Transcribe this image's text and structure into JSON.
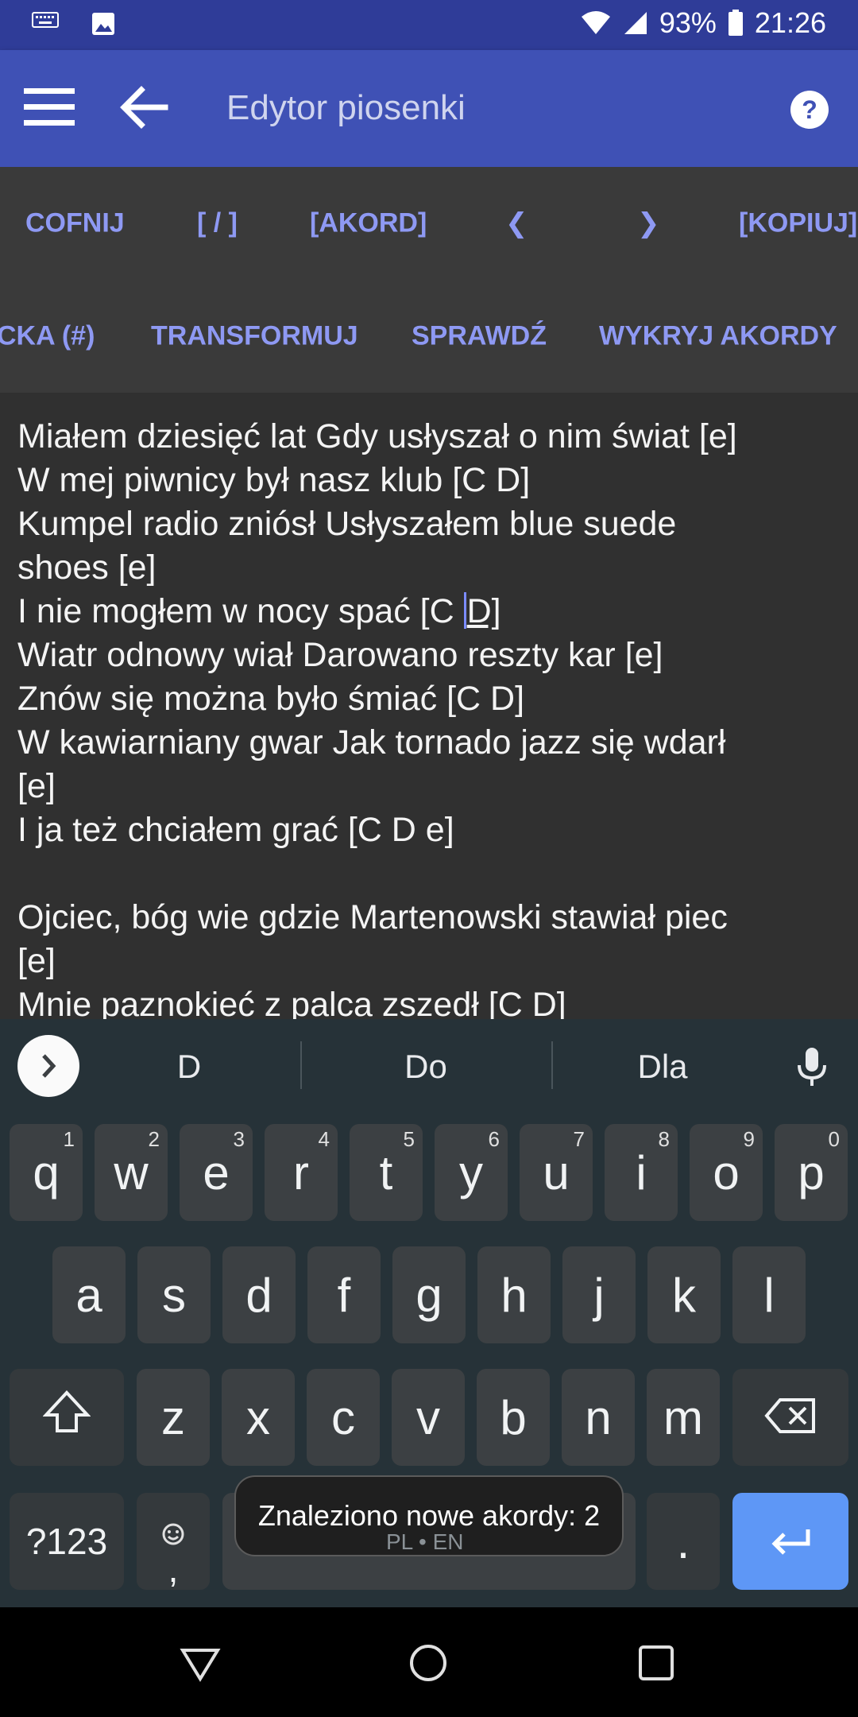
{
  "status_bar": {
    "left_icons": [
      "keyboard-icon",
      "image-icon"
    ],
    "battery_percent": "93%",
    "time": "21:26",
    "right_icons": [
      "wifi-icon",
      "signal-icon",
      "battery-icon"
    ]
  },
  "app_bar": {
    "title": "Edytor piosenki",
    "icons": [
      "menu-icon",
      "back-arrow-icon",
      "help-icon"
    ]
  },
  "toolbar_row1": {
    "undo": "COFNIJ",
    "slash": "[ / ]",
    "chord": "[AKORD]",
    "left": "❮",
    "right": "❯",
    "copy": "[KOPIUJ]"
  },
  "toolbar_row2": {
    "partial": "CKA (#)",
    "transform": "TRANSFORMUJ",
    "check": "SPRAWDŹ",
    "detect": "WYKRYJ AKORDY"
  },
  "editor": {
    "lines": [
      "Miałem dziesięć lat Gdy usłyszał o nim świat [e]",
      "W mej piwnicy był nasz klub [C D]",
      "Kumpel radio zniósł Usłyszałem blue suede",
      "shoes [e]",
      "I nie mogłem w nocy spać [C ",
      "Wiatr odnowy wiał Darowano reszty kar [e]",
      "Znów się można było śmiać [C D]",
      "W kawiarniany gwar Jak tornado jazz się wdarł",
      "[e]",
      "I ja też chciałem grać [C D e]",
      "",
      "Ojciec, bóg wie gdzie Martenowski stawiał piec",
      "[e]",
      "Mnie paznokieć z palca zszedł [C D]"
    ],
    "cursor_line_after": "D]"
  },
  "keyboard": {
    "suggestions": [
      "D",
      "Do",
      "Dla"
    ],
    "row1": [
      {
        "k": "q",
        "h": "1"
      },
      {
        "k": "w",
        "h": "2"
      },
      {
        "k": "e",
        "h": "3"
      },
      {
        "k": "r",
        "h": "4"
      },
      {
        "k": "t",
        "h": "5"
      },
      {
        "k": "y",
        "h": "6"
      },
      {
        "k": "u",
        "h": "7"
      },
      {
        "k": "i",
        "h": "8"
      },
      {
        "k": "o",
        "h": "9"
      },
      {
        "k": "p",
        "h": "0"
      }
    ],
    "row2": [
      "a",
      "s",
      "d",
      "f",
      "g",
      "h",
      "j",
      "k",
      "l"
    ],
    "row3": [
      "z",
      "x",
      "c",
      "v",
      "b",
      "n",
      "m"
    ],
    "symbols": "?123",
    "comma": ",",
    "period": ".",
    "language": "PL • EN",
    "icons": [
      "shift-icon",
      "backspace-icon",
      "emoji-icon",
      "enter-icon",
      "mic-icon",
      "chevron-right-icon"
    ]
  },
  "toast": "Znaleziono nowe akordy: 2",
  "nav_bar": {
    "icons": [
      "back-triangle-icon",
      "home-circle-icon",
      "recents-square-icon"
    ]
  }
}
